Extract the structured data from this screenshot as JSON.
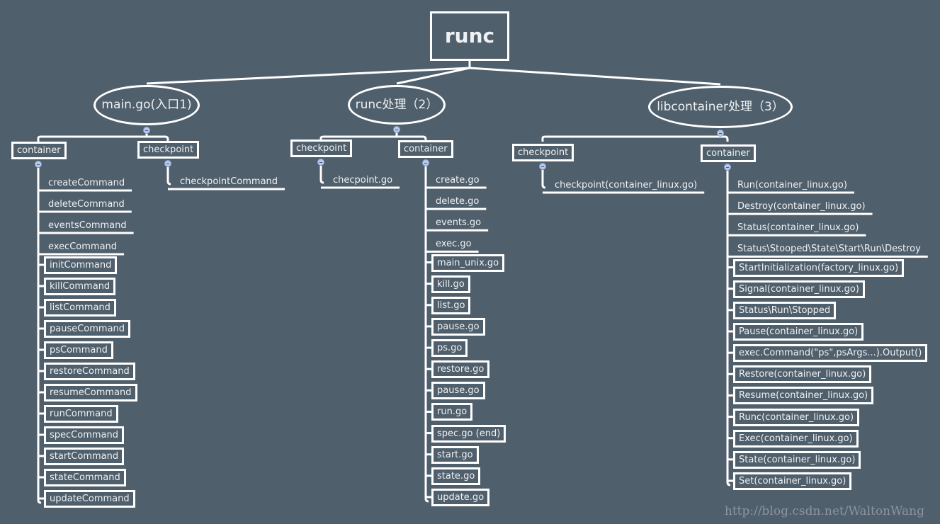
{
  "root": {
    "label": "runc"
  },
  "branches": [
    {
      "label": "main.go(入口1)",
      "groups": [
        {
          "label": "container",
          "items": [
            {
              "label": "createCommand",
              "boxed": false
            },
            {
              "label": "deleteCommand",
              "boxed": false
            },
            {
              "label": "eventsCommand",
              "boxed": false
            },
            {
              "label": "execCommand",
              "boxed": false
            },
            {
              "label": "initCommand",
              "boxed": true
            },
            {
              "label": "killCommand",
              "boxed": true
            },
            {
              "label": "listCommand",
              "boxed": true
            },
            {
              "label": "pauseCommand",
              "boxed": true
            },
            {
              "label": "psCommand",
              "boxed": true
            },
            {
              "label": "restoreCommand",
              "boxed": true
            },
            {
              "label": "resumeCommand",
              "boxed": true
            },
            {
              "label": "runCommand",
              "boxed": true
            },
            {
              "label": "specCommand",
              "boxed": true
            },
            {
              "label": "startCommand",
              "boxed": true
            },
            {
              "label": "stateCommand",
              "boxed": true
            },
            {
              "label": "updateCommand",
              "boxed": true
            }
          ]
        },
        {
          "label": "checkpoint",
          "items": [
            {
              "label": "checkpointCommand",
              "boxed": false
            }
          ]
        }
      ]
    },
    {
      "label": "runc处理（2）",
      "groups": [
        {
          "label": "checkpoint",
          "items": [
            {
              "label": "checpoint.go",
              "boxed": false
            }
          ]
        },
        {
          "label": "container",
          "items": [
            {
              "label": "create.go",
              "boxed": false
            },
            {
              "label": "delete.go",
              "boxed": false
            },
            {
              "label": "events.go",
              "boxed": false
            },
            {
              "label": "exec.go",
              "boxed": false
            },
            {
              "label": "main_unix.go",
              "boxed": true
            },
            {
              "label": "kill.go",
              "boxed": true
            },
            {
              "label": "list.go",
              "boxed": true
            },
            {
              "label": "pause.go",
              "boxed": true
            },
            {
              "label": "ps.go",
              "boxed": true
            },
            {
              "label": "restore.go",
              "boxed": true
            },
            {
              "label": "pause.go",
              "boxed": true
            },
            {
              "label": "run.go",
              "boxed": true
            },
            {
              "label": "spec.go (end)",
              "boxed": true
            },
            {
              "label": "start.go",
              "boxed": true
            },
            {
              "label": "state.go",
              "boxed": true
            },
            {
              "label": "update.go",
              "boxed": true
            }
          ]
        }
      ]
    },
    {
      "label": "libcontainer处理（3）",
      "groups": [
        {
          "label": "checkpoint",
          "items": [
            {
              "label": "checkpoint(container_linux.go)",
              "boxed": false
            }
          ]
        },
        {
          "label": "container",
          "items": [
            {
              "label": "Run(container_linux.go)",
              "boxed": false
            },
            {
              "label": "Destroy(container_linux.go)",
              "boxed": false
            },
            {
              "label": "Status(container_linux.go)",
              "boxed": false
            },
            {
              "label": "Status\\Stooped\\State\\Start\\Run\\Destroy",
              "boxed": false
            },
            {
              "label": "StartInitialization(factory_linux.go)",
              "boxed": true
            },
            {
              "label": "Signal(container_linux.go)",
              "boxed": true
            },
            {
              "label": "Status\\Run\\Stopped",
              "boxed": true
            },
            {
              "label": "Pause(container_linux.go)",
              "boxed": true
            },
            {
              "label": "exec.Command(\"ps\",psArgs...).Output()",
              "boxed": true
            },
            {
              "label": "Restore(container_linux.go)",
              "boxed": true
            },
            {
              "label": "Resume(container_linux.go)",
              "boxed": true
            },
            {
              "label": "Runc(container_linux.go)",
              "boxed": true
            },
            {
              "label": "Exec(container_linux.go)",
              "boxed": true
            },
            {
              "label": "State(container_linux.go)",
              "boxed": true
            },
            {
              "label": "Set(container_linux.go)",
              "boxed": true
            }
          ]
        }
      ]
    }
  ],
  "watermark": "http://blog.csdn.net/WaltonWang"
}
